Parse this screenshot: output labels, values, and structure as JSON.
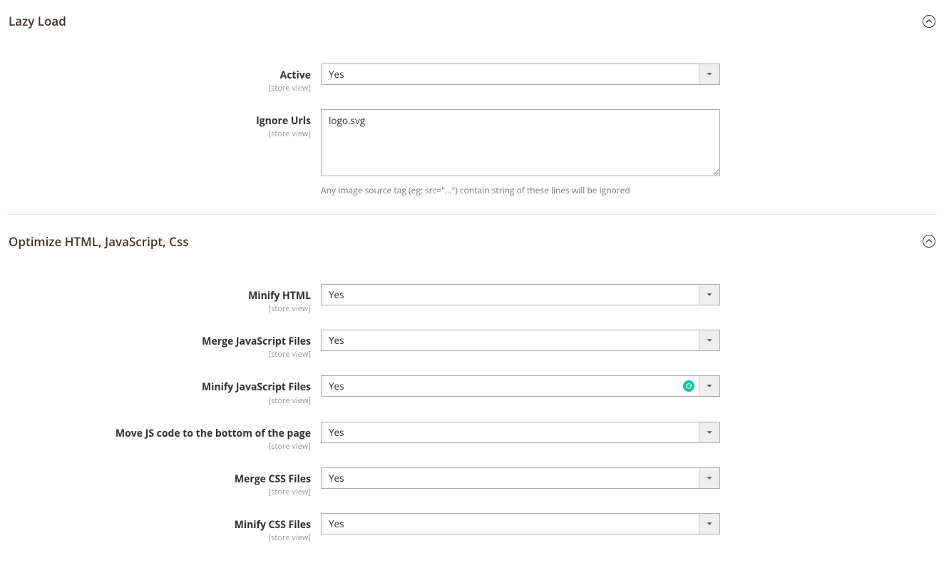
{
  "scope_label": "[store view]",
  "sections": {
    "lazy_load": {
      "title": "Lazy Load",
      "fields": {
        "active": {
          "label": "Active",
          "value": "Yes"
        },
        "ignore_urls": {
          "label": "Ignore Urls",
          "value": "logo.svg",
          "hint": "Any Image source tag (eg: src=\"...\") contain string of these lines will be ignored"
        }
      }
    },
    "optimize": {
      "title": "Optimize HTML, JavaScript, Css",
      "fields": {
        "minify_html": {
          "label": "Minify HTML",
          "value": "Yes"
        },
        "merge_js": {
          "label": "Merge JavaScript Files",
          "value": "Yes"
        },
        "minify_js": {
          "label": "Minify JavaScript Files",
          "value": "Yes"
        },
        "move_js_bottom": {
          "label": "Move JS code to the bottom of the page",
          "value": "Yes"
        },
        "merge_css": {
          "label": "Merge CSS Files",
          "value": "Yes"
        },
        "minify_css": {
          "label": "Minify CSS Files",
          "value": "Yes"
        }
      }
    }
  }
}
